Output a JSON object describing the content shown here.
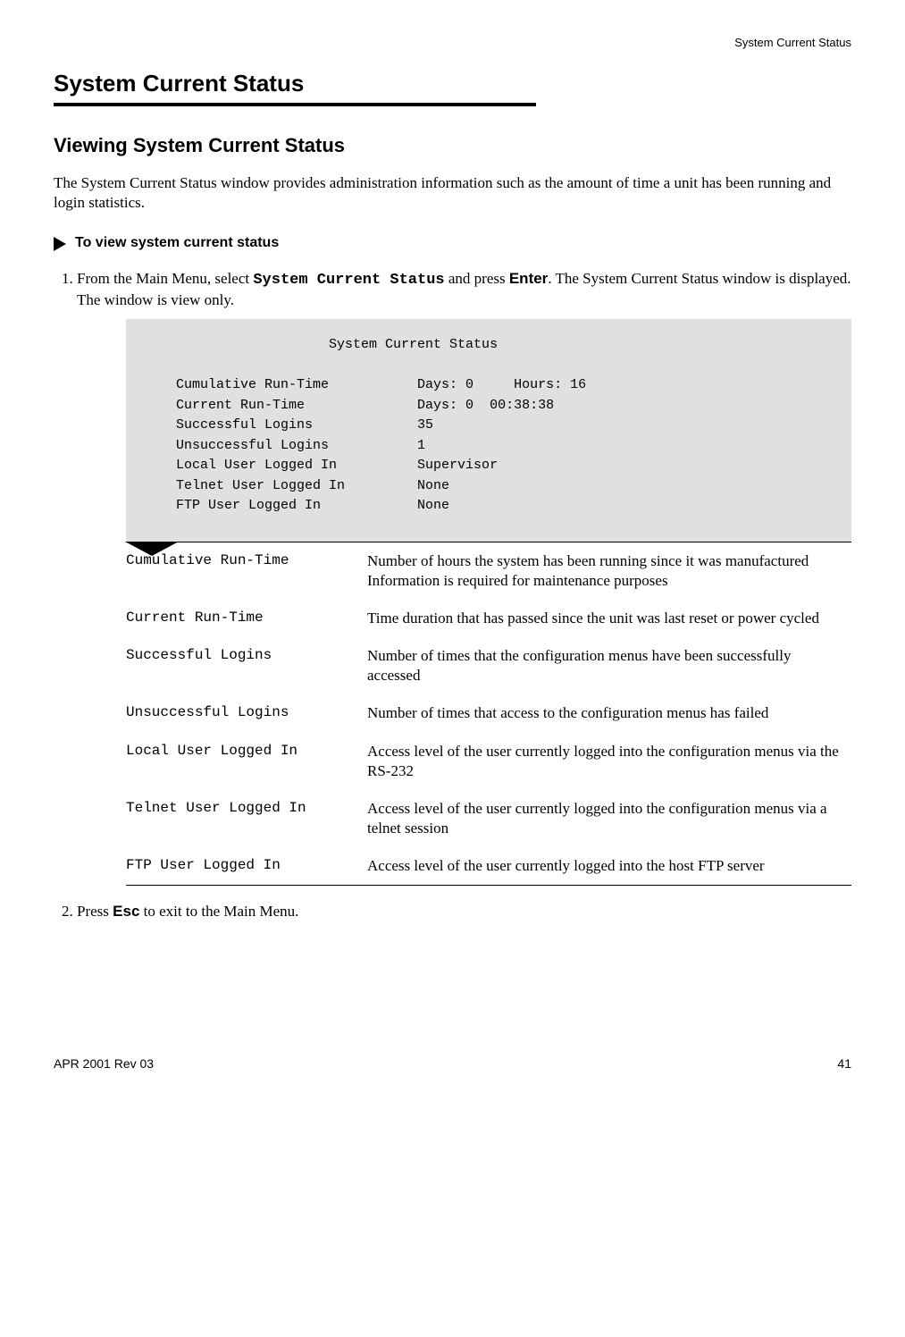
{
  "header": {
    "label": "System Current Status"
  },
  "title": "System Current Status",
  "subtitle": "Viewing System Current Status",
  "intro": "The System Current Status window provides administration information such as the amount of time a unit has been running and login statistics.",
  "procedure_title": "To view system current status",
  "step1": {
    "prefix": "From the Main Menu, select ",
    "cmd": "System Current Status",
    "mid": " and press ",
    "key": "Enter",
    "suffix": ". The System Current Status window is displayed. The window is view only."
  },
  "terminal": {
    "title": "System Current Status",
    "rows": [
      {
        "label": "Cumulative Run-Time",
        "value": "Days: 0     Hours: 16"
      },
      {
        "label": "Current Run-Time",
        "value": "Days: 0  00:38:38"
      },
      {
        "label": "Successful Logins",
        "value": "35"
      },
      {
        "label": "Unsuccessful Logins",
        "value": "1"
      },
      {
        "label": "Local User Logged In",
        "value": "Supervisor"
      },
      {
        "label": "Telnet User Logged In",
        "value": "None"
      },
      {
        "label": "FTP User Logged In",
        "value": "None"
      }
    ]
  },
  "defs": [
    {
      "term": "Cumulative Run-Time",
      "desc": "Number of hours the system has been running since it was manufactured\nInformation is required for maintenance purposes"
    },
    {
      "term": "Current Run-Time",
      "desc": "Time duration that has passed since the unit was last reset or power cycled"
    },
    {
      "term": "Successful Logins",
      "desc": "Number of times that the configuration menus have been successfully accessed"
    },
    {
      "term": "Unsuccessful Logins",
      "desc": "Number of times that access to the configuration menus has failed"
    },
    {
      "term": "Local User Logged In",
      "desc": "Access level of the user currently logged into the configuration menus via the RS-232"
    },
    {
      "term": "Telnet User Logged In",
      "desc": "Access level of the user currently logged into the configuration menus via a telnet session"
    },
    {
      "term": "FTP User Logged In",
      "desc": "Access level of the user currently logged into the host FTP server"
    }
  ],
  "step2": {
    "prefix": "Press ",
    "key": "Esc",
    "suffix": " to exit to the Main Menu."
  },
  "footer": {
    "left": "APR 2001 Rev 03",
    "right": "41"
  }
}
